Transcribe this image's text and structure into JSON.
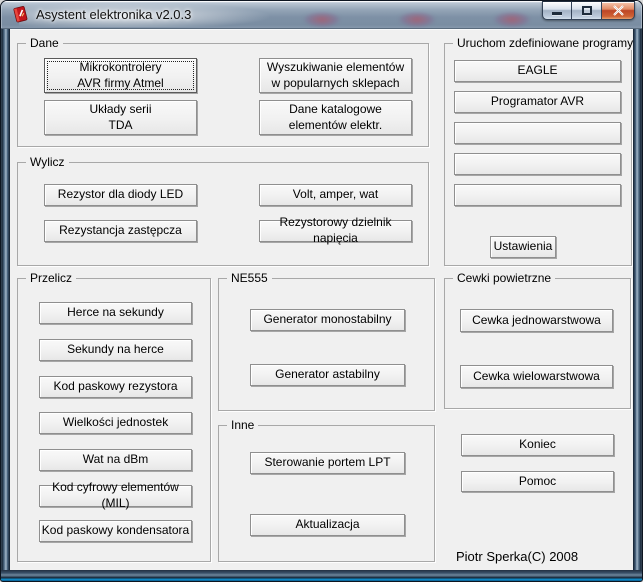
{
  "window": {
    "title": "Asystent elektronika v2.0.3"
  },
  "icons": {
    "app": "red-book-app-icon",
    "minimize": "minimize-icon",
    "maximize": "maximize-icon",
    "close": "close-icon"
  },
  "colors": {
    "client_background": "#f0f0f0",
    "titlebar_glass": "#7f93a9",
    "close_button_red": "#bd4526",
    "frame_bottom_glow": "#1193d2"
  },
  "groups": {
    "dane": {
      "label": "Dane",
      "buttons": [
        "Mikrokontrolery\nAVR firmy Atmel",
        "Układy serii\nTDA",
        "Wyszukiwanie elementów\nw popularnych sklepach",
        "Dane katalogowe\nelementów elektr."
      ]
    },
    "wylicz": {
      "label": "Wylicz",
      "buttons": [
        "Rezystor dla diody LED",
        "Rezystancja zastępcza",
        "Volt, amper, wat",
        "Rezystorowy dzielnik napięcia"
      ]
    },
    "uruchom": {
      "label": "Uruchom zdefiniowane programy",
      "buttons": [
        "EAGLE",
        "Programator AVR",
        "",
        "",
        ""
      ],
      "settings_label": "Ustawienia"
    },
    "przelicz": {
      "label": "Przelicz",
      "buttons": [
        "Herce na sekundy",
        "Sekundy na herce",
        "Kod paskowy rezystora",
        "Wielkości jednostek",
        "Wat na dBm",
        "Kod cyfrowy elementów (MIL)",
        "Kod paskowy kondensatora"
      ]
    },
    "ne555": {
      "label": "NE555",
      "buttons": [
        "Generator monostabilny",
        "Generator astabilny"
      ]
    },
    "inne": {
      "label": "Inne",
      "buttons": [
        "Sterowanie portem LPT",
        "Aktualizacja"
      ]
    },
    "cewki": {
      "label": "Cewki powietrzne",
      "buttons": [
        "Cewka jednowarstwowa",
        "Cewka wielowarstwowa"
      ]
    }
  },
  "footer": {
    "quit_label": "Koniec",
    "help_label": "Pomoc",
    "copyright": "Piotr Sperka(C) 2008"
  }
}
